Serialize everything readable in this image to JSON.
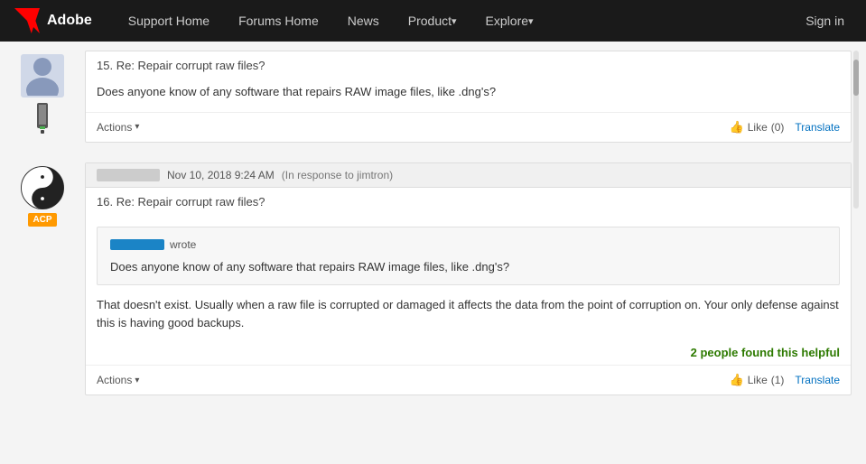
{
  "nav": {
    "logo_text": "Adobe",
    "links": [
      {
        "label": "Support Home",
        "has_arrow": false
      },
      {
        "label": "Forums Home",
        "has_arrow": false
      },
      {
        "label": "News",
        "has_arrow": false
      },
      {
        "label": "Product",
        "has_arrow": true
      },
      {
        "label": "Explore",
        "has_arrow": true
      }
    ],
    "signin": "Sign in"
  },
  "post15": {
    "number": "15.",
    "title": "Re: Repair corrupt raw files?",
    "body": "Does anyone know of any software that repairs RAW image files, like .dng's?",
    "actions": "Actions",
    "like_label": "Like",
    "like_count": "(0)",
    "translate": "Translate"
  },
  "post16": {
    "number": "16.",
    "title": "Re: Repair corrupt raw files?",
    "date": "Nov 10, 2018 9:24 AM",
    "in_response": "(In response to jimtron)",
    "quote_author": "wrote",
    "quote_body": "Does anyone know of any software that repairs RAW image files, like .dng's?",
    "body": "That doesn't exist. Usually when a raw file is corrupted or damaged it affects the data from the point of corruption on. Your only defense against this is having good backups.",
    "helpful": "2 people found this helpful",
    "actions": "Actions",
    "like_label": "Like",
    "like_count": "(1)",
    "translate": "Translate",
    "badge": "ACP"
  }
}
